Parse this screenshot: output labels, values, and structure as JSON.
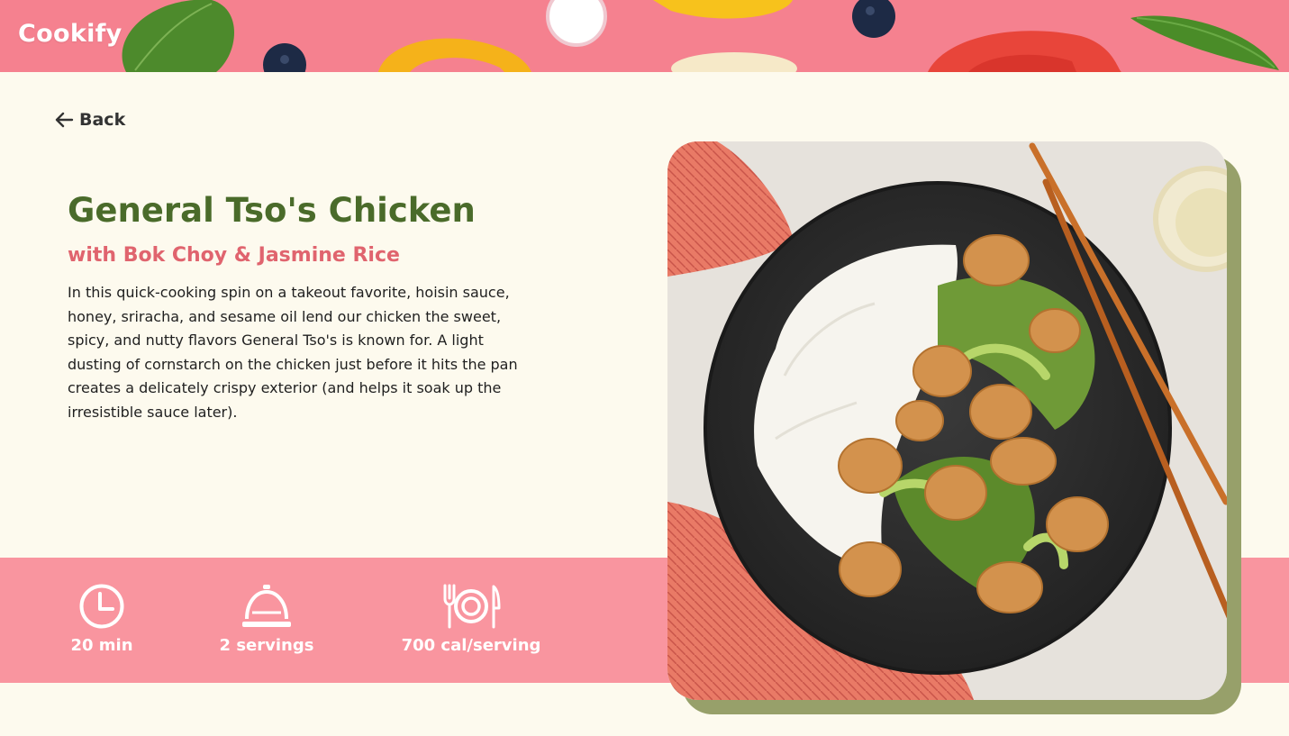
{
  "header": {
    "brand": "Cookify"
  },
  "nav": {
    "back_label": "Back"
  },
  "recipe": {
    "title": "General Tso's Chicken",
    "subtitle": "with Bok Choy & Jasmine Rice",
    "description": "In this quick-cooking spin on a takeout favorite, hoisin sauce, honey, sriracha, and sesame oil lend our chicken the sweet, spicy, and nutty flavors General Tso's is known for. A light dusting of cornstarch on the chicken just before it hits the pan creates a delicately crispy exterior (and helps it soak up the irresistible sauce later)."
  },
  "stats": {
    "time": {
      "icon": "clock-icon",
      "label": "20 min"
    },
    "servings": {
      "icon": "cloche-icon",
      "label": "2 servings"
    },
    "calories": {
      "icon": "plate-cutlery-icon",
      "label": "700 cal/serving"
    }
  },
  "colors": {
    "header_pink": "#f5818f",
    "band_pink": "#f9959f",
    "title_green": "#4a6b2a",
    "subtitle_red": "#e0646e",
    "background_cream": "#fdfaee",
    "photo_shadow_olive": "#97a06a"
  }
}
